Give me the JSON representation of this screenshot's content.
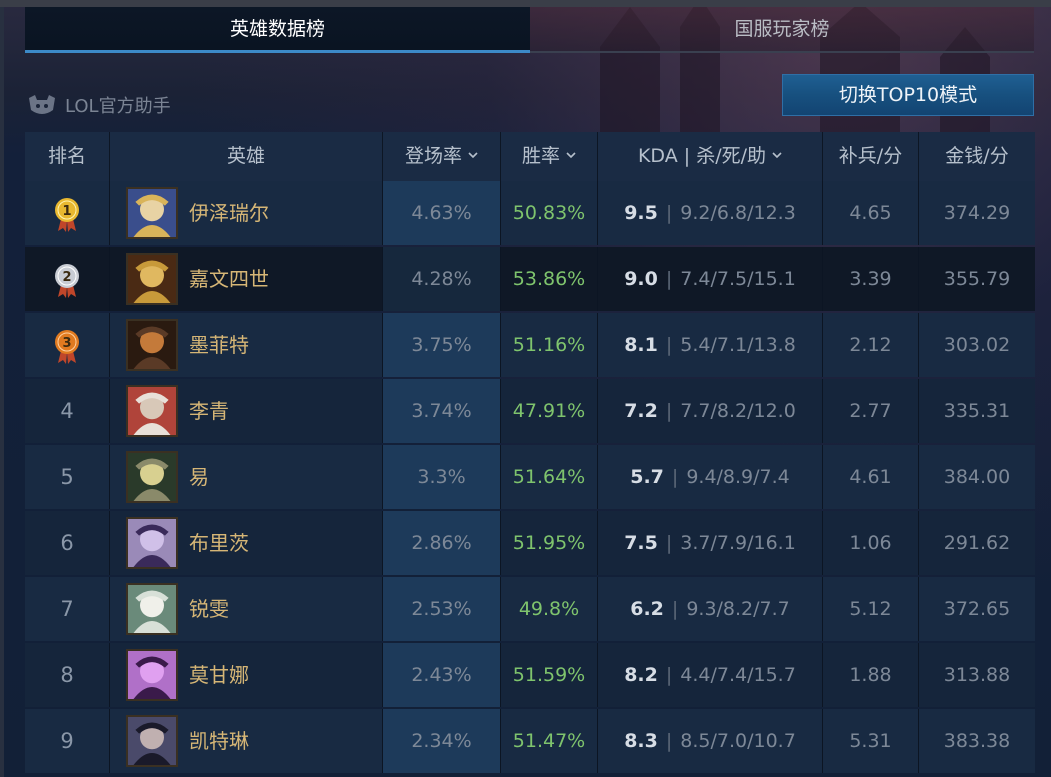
{
  "tabs": [
    {
      "label": "英雄数据榜",
      "active": true
    },
    {
      "label": "国服玩家榜",
      "active": false
    }
  ],
  "brand": {
    "label": "LOL官方助手",
    "icon": "lol-helper-logo-icon"
  },
  "switch_button": {
    "label": "切换TOP10模式"
  },
  "table": {
    "headers": {
      "rank": "排名",
      "hero": "英雄",
      "appear": "登场率",
      "win": "胜率",
      "kda": "KDA | 杀/死/助",
      "cs": "补兵/分",
      "gold": "金钱/分"
    },
    "sort_icon": "chevron-down-icon",
    "rows": [
      {
        "rank": "1",
        "medal": "gold",
        "hero": "伊泽瑞尔",
        "appear": "4.63%",
        "win": "50.83%",
        "kda": "9.5",
        "kda_detail": "9.2/6.8/12.3",
        "cs": "4.65",
        "gold": "374.29",
        "avatar": [
          "#d9b45a",
          "#3a4e8c",
          "#e8d3a4"
        ]
      },
      {
        "rank": "2",
        "medal": "silver",
        "hero": "嘉文四世",
        "appear": "4.28%",
        "win": "53.86%",
        "kda": "9.0",
        "kda_detail": "7.4/7.5/15.1",
        "cs": "3.39",
        "gold": "355.79",
        "avatar": [
          "#c89a3a",
          "#4a2a14",
          "#e0b860"
        ]
      },
      {
        "rank": "3",
        "medal": "bronze",
        "hero": "墨菲特",
        "appear": "3.75%",
        "win": "51.16%",
        "kda": "8.1",
        "kda_detail": "5.4/7.1/13.8",
        "cs": "2.12",
        "gold": "303.02",
        "avatar": [
          "#5a3a26",
          "#2a1a10",
          "#c47a3a"
        ]
      },
      {
        "rank": "4",
        "medal": "",
        "hero": "李青",
        "appear": "3.74%",
        "win": "47.91%",
        "kda": "7.2",
        "kda_detail": "7.7/8.2/12.0",
        "cs": "2.77",
        "gold": "335.31",
        "avatar": [
          "#e8e0d8",
          "#b0443a",
          "#d8c8b8"
        ]
      },
      {
        "rank": "5",
        "medal": "",
        "hero": "易",
        "appear": "3.3%",
        "win": "51.64%",
        "kda": "5.7",
        "kda_detail": "9.4/8.9/7.4",
        "cs": "4.61",
        "gold": "384.00",
        "avatar": [
          "#8a8a6a",
          "#2a3a2a",
          "#d8d090"
        ]
      },
      {
        "rank": "6",
        "medal": "",
        "hero": "布里茨",
        "appear": "2.86%",
        "win": "51.95%",
        "kda": "7.5",
        "kda_detail": "3.7/7.9/16.1",
        "cs": "1.06",
        "gold": "291.62",
        "avatar": [
          "#3a2a5a",
          "#9a8ab8",
          "#d0c0e8"
        ]
      },
      {
        "rank": "7",
        "medal": "",
        "hero": "锐雯",
        "appear": "2.53%",
        "win": "49.8%",
        "kda": "6.2",
        "kda_detail": "9.3/8.2/7.7",
        "cs": "5.12",
        "gold": "372.65",
        "avatar": [
          "#d8e0d8",
          "#6a8a7a",
          "#f0f0ea"
        ]
      },
      {
        "rank": "8",
        "medal": "",
        "hero": "莫甘娜",
        "appear": "2.43%",
        "win": "51.59%",
        "kda": "8.2",
        "kda_detail": "4.4/7.4/15.7",
        "cs": "1.88",
        "gold": "313.88",
        "avatar": [
          "#3a1a4a",
          "#b070c8",
          "#e0a0f0"
        ]
      },
      {
        "rank": "9",
        "medal": "",
        "hero": "凯特琳",
        "appear": "2.34%",
        "win": "51.47%",
        "kda": "8.3",
        "kda_detail": "8.5/7.0/10.7",
        "cs": "5.31",
        "gold": "383.38",
        "avatar": [
          "#1a1a2a",
          "#4a4a6a",
          "#c0b0b0"
        ]
      }
    ]
  },
  "colors": {
    "accent": "#3c8ac8",
    "win_rate": "#7fc46d",
    "hero_name": "#d6b676",
    "medal_gold": "#e8b830",
    "medal_silver": "#c8ccd4",
    "medal_bronze": "#e07a20"
  }
}
